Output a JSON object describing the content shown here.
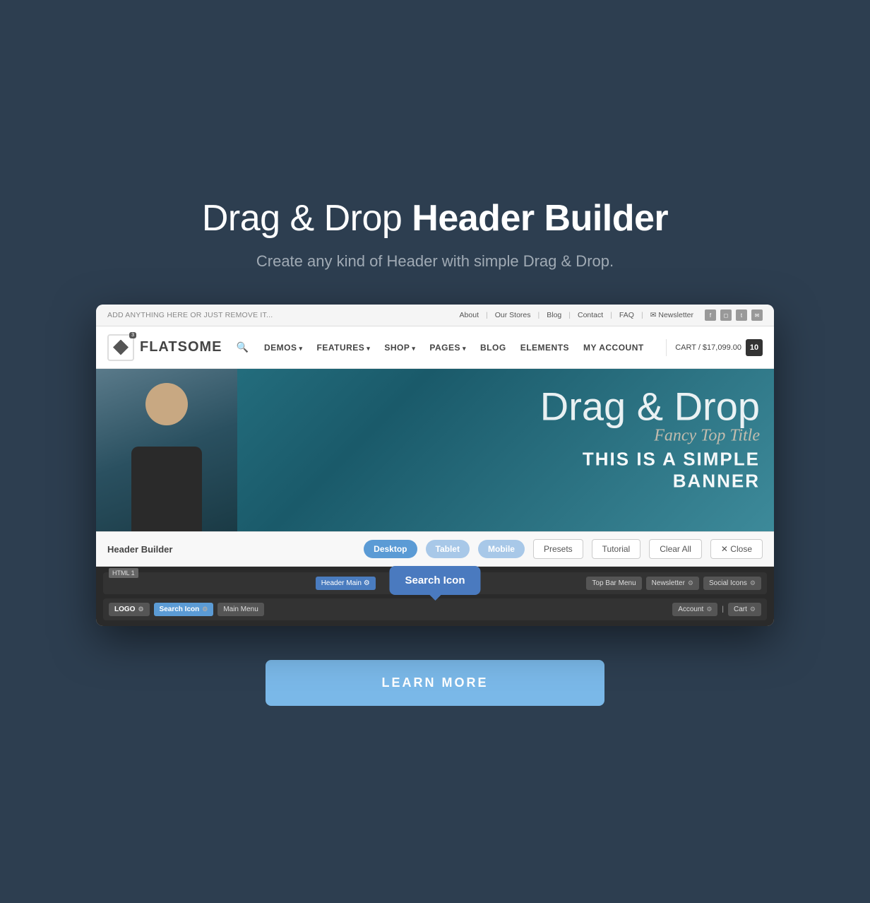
{
  "page": {
    "bg_color": "#2d3e50",
    "title": "Drag & Drop Header Builder",
    "title_normal": "Drag & Drop ",
    "title_bold": "Header Builder",
    "subtitle": "Create any kind of Header with simple Drag & Drop."
  },
  "topbar": {
    "left_text": "ADD ANYTHING HERE OR JUST REMOVE IT...",
    "links": [
      "About",
      "Our Stores",
      "Blog",
      "Contact",
      "FAQ"
    ],
    "newsletter": "Newsletter",
    "social_icons": [
      "f",
      "📷",
      "t",
      "✉"
    ]
  },
  "mainnav": {
    "logo_text": "FLATSOME",
    "logo_badge": "3",
    "search_icon": "🔍",
    "links": [
      {
        "label": "DEMOS",
        "arrow": true
      },
      {
        "label": "FEATURES",
        "arrow": true
      },
      {
        "label": "SHOP",
        "arrow": true
      },
      {
        "label": "PAGES",
        "arrow": true
      },
      {
        "label": "BLOG",
        "arrow": false
      },
      {
        "label": "ELEMENTS",
        "arrow": false
      },
      {
        "label": "MY ACCOUNT",
        "arrow": false
      }
    ],
    "cart_label": "CART / $17,099.00",
    "cart_count": "10"
  },
  "banner": {
    "main_title": "Drag & Drop",
    "fancy_title": "Fancy Top Title",
    "subtitle": "THIS IS A SIMPLE\nBANNER"
  },
  "header_builder": {
    "title": "Header Builder",
    "views": [
      {
        "label": "Desktop",
        "active": true
      },
      {
        "label": "Tablet",
        "active": false
      },
      {
        "label": "Mobile",
        "active": false
      }
    ],
    "actions": [
      "Presets",
      "Tutorial",
      "Clear All"
    ],
    "close_label": "✕ Close",
    "rows": [
      {
        "id": "html1",
        "badge": "HTML 1",
        "elements_right": [
          "Top Bar Menu",
          "Newsletter ⚙",
          "Social Icons ⚙"
        ]
      },
      {
        "id": "header-main",
        "badge": "Header Main ⚙",
        "elements_left": [
          "LOGO ⚙",
          "Search Icon ⚙",
          "Main Menu"
        ],
        "elements_right": [
          "Account ⚙",
          "|",
          "Cart ⚙"
        ]
      }
    ],
    "tooltip": "Search Icon",
    "cursor": "☛"
  },
  "cta": {
    "label": "LEARN MORE"
  }
}
